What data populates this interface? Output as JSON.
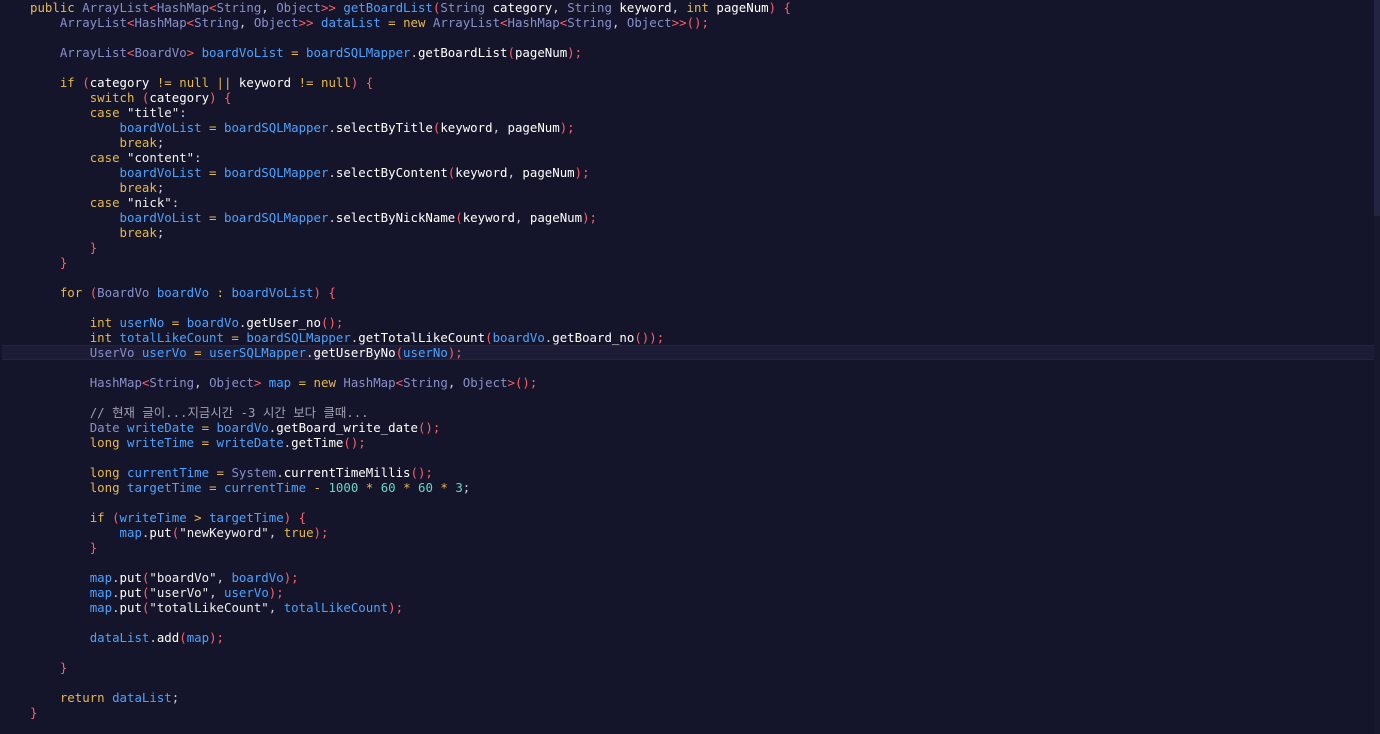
{
  "editor": {
    "current_line": 23,
    "lines": [
      [
        [
          "kw",
          "public "
        ],
        [
          "ty",
          "ArrayList"
        ],
        [
          "pn",
          "<"
        ],
        [
          "ty",
          "HashMap"
        ],
        [
          "pn",
          "<"
        ],
        [
          "ty",
          "String"
        ],
        [
          "df",
          ", "
        ],
        [
          "ty",
          "Object"
        ],
        [
          "pn",
          ">> "
        ],
        [
          "fd",
          "getBoardList"
        ],
        [
          "pn",
          "("
        ],
        [
          "ty",
          "String "
        ],
        [
          "fn",
          "category"
        ],
        [
          "df",
          ", "
        ],
        [
          "ty",
          "String "
        ],
        [
          "fn",
          "keyword"
        ],
        [
          "df",
          ", "
        ],
        [
          "kw",
          "int "
        ],
        [
          "fn",
          "pageNum"
        ],
        [
          "pn",
          ") {"
        ]
      ],
      [
        [
          "df",
          "    "
        ],
        [
          "ty",
          "ArrayList"
        ],
        [
          "pn",
          "<"
        ],
        [
          "ty",
          "HashMap"
        ],
        [
          "pn",
          "<"
        ],
        [
          "ty",
          "String"
        ],
        [
          "df",
          ", "
        ],
        [
          "ty",
          "Object"
        ],
        [
          "pn",
          ">> "
        ],
        [
          "fd",
          "dataList"
        ],
        [
          "op",
          " = "
        ],
        [
          "kw",
          "new "
        ],
        [
          "ty",
          "ArrayList"
        ],
        [
          "pn",
          "<"
        ],
        [
          "ty",
          "HashMap"
        ],
        [
          "pn",
          "<"
        ],
        [
          "ty",
          "String"
        ],
        [
          "df",
          ", "
        ],
        [
          "ty",
          "Object"
        ],
        [
          "pn",
          ">>();"
        ]
      ],
      [],
      [
        [
          "df",
          "    "
        ],
        [
          "ty",
          "ArrayList"
        ],
        [
          "pn",
          "<"
        ],
        [
          "ty",
          "BoardVo"
        ],
        [
          "pn",
          "> "
        ],
        [
          "fd",
          "boardVoList"
        ],
        [
          "op",
          " = "
        ],
        [
          "fd",
          "boardSQLMapper"
        ],
        [
          "df",
          "."
        ],
        [
          "fn",
          "getBoardList"
        ],
        [
          "pn",
          "("
        ],
        [
          "fn",
          "pageNum"
        ],
        [
          "pn",
          ");"
        ]
      ],
      [],
      [
        [
          "df",
          "    "
        ],
        [
          "kw",
          "if "
        ],
        [
          "pn",
          "("
        ],
        [
          "fn",
          "category"
        ],
        [
          "op",
          " != "
        ],
        [
          "kw",
          "null"
        ],
        [
          "op",
          " || "
        ],
        [
          "fn",
          "keyword"
        ],
        [
          "op",
          " != "
        ],
        [
          "kw",
          "null"
        ],
        [
          "pn",
          ") {"
        ]
      ],
      [
        [
          "df",
          "        "
        ],
        [
          "kw",
          "switch "
        ],
        [
          "pn",
          "("
        ],
        [
          "fn",
          "category"
        ],
        [
          "pn",
          ") {"
        ]
      ],
      [
        [
          "df",
          "        "
        ],
        [
          "kw",
          "case "
        ],
        [
          "st",
          "\"title\""
        ],
        [
          "df",
          ":"
        ]
      ],
      [
        [
          "df",
          "            "
        ],
        [
          "fd",
          "boardVoList"
        ],
        [
          "op",
          " = "
        ],
        [
          "fd",
          "boardSQLMapper"
        ],
        [
          "df",
          "."
        ],
        [
          "fn",
          "selectByTitle"
        ],
        [
          "pn",
          "("
        ],
        [
          "fn",
          "keyword"
        ],
        [
          "df",
          ", "
        ],
        [
          "fn",
          "pageNum"
        ],
        [
          "pn",
          ");"
        ]
      ],
      [
        [
          "df",
          "            "
        ],
        [
          "kw",
          "break"
        ],
        [
          "df",
          ";"
        ]
      ],
      [
        [
          "df",
          "        "
        ],
        [
          "kw",
          "case "
        ],
        [
          "st",
          "\"content\""
        ],
        [
          "df",
          ":"
        ]
      ],
      [
        [
          "df",
          "            "
        ],
        [
          "fd",
          "boardVoList"
        ],
        [
          "op",
          " = "
        ],
        [
          "fd",
          "boardSQLMapper"
        ],
        [
          "df",
          "."
        ],
        [
          "fn",
          "selectByContent"
        ],
        [
          "pn",
          "("
        ],
        [
          "fn",
          "keyword"
        ],
        [
          "df",
          ", "
        ],
        [
          "fn",
          "pageNum"
        ],
        [
          "pn",
          ");"
        ]
      ],
      [
        [
          "df",
          "            "
        ],
        [
          "kw",
          "break"
        ],
        [
          "df",
          ";"
        ]
      ],
      [
        [
          "df",
          "        "
        ],
        [
          "kw",
          "case "
        ],
        [
          "st",
          "\"nick\""
        ],
        [
          "df",
          ":"
        ]
      ],
      [
        [
          "df",
          "            "
        ],
        [
          "fd",
          "boardVoList"
        ],
        [
          "op",
          " = "
        ],
        [
          "fd",
          "boardSQLMapper"
        ],
        [
          "df",
          "."
        ],
        [
          "fn",
          "selectByNickName"
        ],
        [
          "pn",
          "("
        ],
        [
          "fn",
          "keyword"
        ],
        [
          "df",
          ", "
        ],
        [
          "fn",
          "pageNum"
        ],
        [
          "pn",
          ");"
        ]
      ],
      [
        [
          "df",
          "            "
        ],
        [
          "kw",
          "break"
        ],
        [
          "df",
          ";"
        ]
      ],
      [
        [
          "df",
          "        "
        ],
        [
          "pn",
          "}"
        ]
      ],
      [
        [
          "df",
          "    "
        ],
        [
          "pn",
          "}"
        ]
      ],
      [],
      [
        [
          "df",
          "    "
        ],
        [
          "kw",
          "for "
        ],
        [
          "pn",
          "("
        ],
        [
          "ty",
          "BoardVo "
        ],
        [
          "fd",
          "boardVo"
        ],
        [
          "op",
          " : "
        ],
        [
          "fd",
          "boardVoList"
        ],
        [
          "pn",
          ") {"
        ]
      ],
      [],
      [
        [
          "df",
          "        "
        ],
        [
          "kw",
          "int "
        ],
        [
          "fd",
          "userNo"
        ],
        [
          "op",
          " = "
        ],
        [
          "fd",
          "boardVo"
        ],
        [
          "df",
          "."
        ],
        [
          "fn",
          "getUser_no"
        ],
        [
          "pn",
          "();"
        ]
      ],
      [
        [
          "df",
          "        "
        ],
        [
          "kw",
          "int "
        ],
        [
          "fd",
          "totalLikeCount"
        ],
        [
          "op",
          " = "
        ],
        [
          "fd",
          "boardSQLMapper"
        ],
        [
          "df",
          "."
        ],
        [
          "fn",
          "getTotalLikeCount"
        ],
        [
          "pn",
          "("
        ],
        [
          "fd",
          "boardVo"
        ],
        [
          "df",
          "."
        ],
        [
          "fn",
          "getBoard_no"
        ],
        [
          "pn",
          "());"
        ]
      ],
      [
        [
          "df",
          "        "
        ],
        [
          "ty",
          "UserVo "
        ],
        [
          "fd",
          "userVo"
        ],
        [
          "op",
          " = "
        ],
        [
          "fd",
          "userSQLMapper"
        ],
        [
          "df",
          "."
        ],
        [
          "fn",
          "getUserByNo"
        ],
        [
          "pn",
          "("
        ],
        [
          "fd",
          "userNo"
        ],
        [
          "pn",
          ");"
        ]
      ],
      [],
      [
        [
          "df",
          "        "
        ],
        [
          "ty",
          "HashMap"
        ],
        [
          "pn",
          "<"
        ],
        [
          "ty",
          "String"
        ],
        [
          "df",
          ", "
        ],
        [
          "ty",
          "Object"
        ],
        [
          "pn",
          "> "
        ],
        [
          "fd",
          "map"
        ],
        [
          "op",
          " = "
        ],
        [
          "kw",
          "new "
        ],
        [
          "ty",
          "HashMap"
        ],
        [
          "pn",
          "<"
        ],
        [
          "ty",
          "String"
        ],
        [
          "df",
          ", "
        ],
        [
          "ty",
          "Object"
        ],
        [
          "pn",
          ">();"
        ]
      ],
      [],
      [
        [
          "df",
          "        "
        ],
        [
          "cm",
          "// 현재 글이...지금시간 -3 시간 보다 클때..."
        ]
      ],
      [
        [
          "df",
          "        "
        ],
        [
          "ty",
          "Date "
        ],
        [
          "fd",
          "writeDate"
        ],
        [
          "op",
          " = "
        ],
        [
          "fd",
          "boardVo"
        ],
        [
          "df",
          "."
        ],
        [
          "fn",
          "getBoard_write_date"
        ],
        [
          "pn",
          "();"
        ]
      ],
      [
        [
          "df",
          "        "
        ],
        [
          "kw",
          "long "
        ],
        [
          "fd",
          "writeTime"
        ],
        [
          "op",
          " = "
        ],
        [
          "fd",
          "writeDate"
        ],
        [
          "df",
          "."
        ],
        [
          "fn",
          "getTime"
        ],
        [
          "pn",
          "();"
        ]
      ],
      [],
      [
        [
          "df",
          "        "
        ],
        [
          "kw",
          "long "
        ],
        [
          "fd",
          "currentTime"
        ],
        [
          "op",
          " = "
        ],
        [
          "ty",
          "System"
        ],
        [
          "df",
          "."
        ],
        [
          "fn",
          "currentTimeMillis"
        ],
        [
          "pn",
          "();"
        ]
      ],
      [
        [
          "df",
          "        "
        ],
        [
          "kw",
          "long "
        ],
        [
          "fd",
          "targetTime"
        ],
        [
          "op",
          " = "
        ],
        [
          "fd",
          "currentTime"
        ],
        [
          "op",
          " - "
        ],
        [
          "nu",
          "1000"
        ],
        [
          "op",
          " * "
        ],
        [
          "nu",
          "60"
        ],
        [
          "op",
          " * "
        ],
        [
          "nu",
          "60"
        ],
        [
          "op",
          " * "
        ],
        [
          "nu",
          "3"
        ],
        [
          "df",
          ";"
        ]
      ],
      [],
      [
        [
          "df",
          "        "
        ],
        [
          "kw",
          "if "
        ],
        [
          "pn",
          "("
        ],
        [
          "fd",
          "writeTime"
        ],
        [
          "op",
          " > "
        ],
        [
          "fd",
          "targetTime"
        ],
        [
          "pn",
          ") {"
        ]
      ],
      [
        [
          "df",
          "            "
        ],
        [
          "fd",
          "map"
        ],
        [
          "df",
          "."
        ],
        [
          "fn",
          "put"
        ],
        [
          "pn",
          "("
        ],
        [
          "st",
          "\"newKeyword\""
        ],
        [
          "df",
          ", "
        ],
        [
          "bo",
          "true"
        ],
        [
          "pn",
          ");"
        ]
      ],
      [
        [
          "df",
          "        "
        ],
        [
          "pn",
          "}"
        ]
      ],
      [],
      [
        [
          "df",
          "        "
        ],
        [
          "fd",
          "map"
        ],
        [
          "df",
          "."
        ],
        [
          "fn",
          "put"
        ],
        [
          "pn",
          "("
        ],
        [
          "st",
          "\"boardVo\""
        ],
        [
          "df",
          ", "
        ],
        [
          "fd",
          "boardVo"
        ],
        [
          "pn",
          ");"
        ]
      ],
      [
        [
          "df",
          "        "
        ],
        [
          "fd",
          "map"
        ],
        [
          "df",
          "."
        ],
        [
          "fn",
          "put"
        ],
        [
          "pn",
          "("
        ],
        [
          "st",
          "\"userVo\""
        ],
        [
          "df",
          ", "
        ],
        [
          "fd",
          "userVo"
        ],
        [
          "pn",
          ");"
        ]
      ],
      [
        [
          "df",
          "        "
        ],
        [
          "fd",
          "map"
        ],
        [
          "df",
          "."
        ],
        [
          "fn",
          "put"
        ],
        [
          "pn",
          "("
        ],
        [
          "st",
          "\"totalLikeCount\""
        ],
        [
          "df",
          ", "
        ],
        [
          "fd",
          "totalLikeCount"
        ],
        [
          "pn",
          ");"
        ]
      ],
      [],
      [
        [
          "df",
          "        "
        ],
        [
          "fd",
          "dataList"
        ],
        [
          "df",
          "."
        ],
        [
          "fn",
          "add"
        ],
        [
          "pn",
          "("
        ],
        [
          "fd",
          "map"
        ],
        [
          "pn",
          ");"
        ]
      ],
      [],
      [
        [
          "df",
          "    "
        ],
        [
          "pn",
          "}"
        ]
      ],
      [],
      [
        [
          "df",
          "    "
        ],
        [
          "kw",
          "return "
        ],
        [
          "fd",
          "dataList"
        ],
        [
          "df",
          ";"
        ]
      ],
      [
        [
          "pn",
          "}"
        ]
      ]
    ]
  }
}
